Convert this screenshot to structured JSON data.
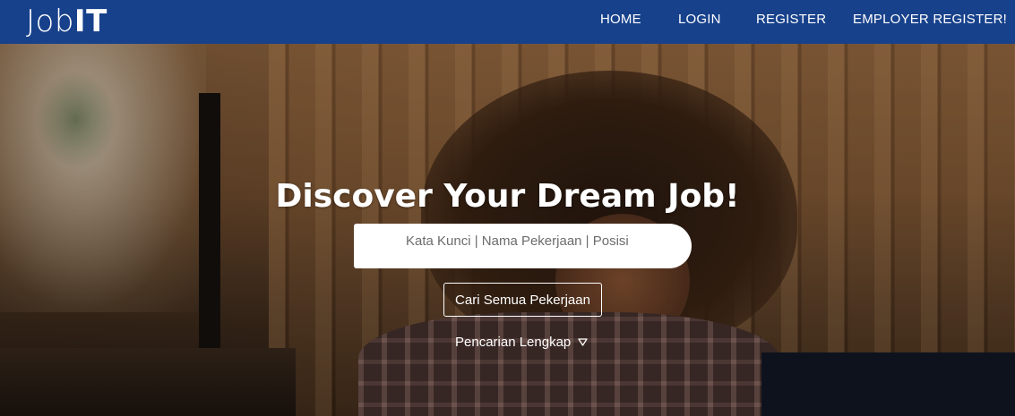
{
  "navbar": {
    "logo_light": "Job",
    "logo_bold": "IT",
    "links": {
      "home": "HOME",
      "login": "LOGIN",
      "register": "REGISTER",
      "employer_register": "EMPLOYER REGISTER!"
    },
    "bg_color": "#17418b"
  },
  "hero": {
    "title": "Discover Your Dream Job!",
    "search": {
      "placeholder": "Kata Kunci | Nama Pekerjaan | Posisi",
      "value": ""
    },
    "search_all_button": "Cari Semua Pekerjaan",
    "advanced_search_link": "Pencarian Lengkap",
    "advanced_search_icon": "caret-down-outline-icon"
  }
}
